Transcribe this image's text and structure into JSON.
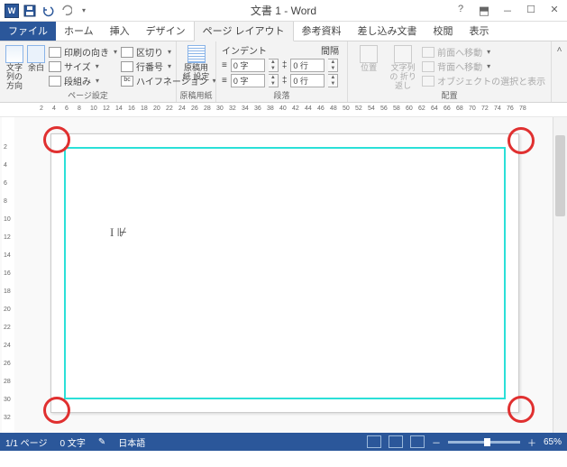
{
  "title": "文書 1 - Word",
  "tabs": {
    "file": "ファイル",
    "home": "ホーム",
    "insert": "挿入",
    "design": "デザイン",
    "pagelayout": "ページ レイアウト",
    "references": "参考資料",
    "mailings": "差し込み文書",
    "review": "校閲",
    "view": "表示"
  },
  "ribbon": {
    "text_dir": "文字列の\n方向",
    "margins": "余白",
    "orientation": "印刷の向き",
    "size": "サイズ",
    "columns": "段組み",
    "breaks": "区切り",
    "line_numbers": "行番号",
    "hyphenation": "ハイフネーション",
    "page_setup_label": "ページ設定",
    "manuscript": "原稿用紙\n設定",
    "manuscript_label": "原稿用紙",
    "indent_label": "インデント",
    "spacing_label": "間隔",
    "left_val": "0 字",
    "right_val": "0 字",
    "before_val": "0 行",
    "after_val": "0 行",
    "paragraph_label": "段落",
    "position": "位置",
    "wrap": "文字列の\n折り返し",
    "bring_forward": "前面へ移動",
    "send_backward": "背面へ移動",
    "selection_pane": "オブジェクトの選択と表示",
    "arrange_label": "配置"
  },
  "ruler_h": [
    "2",
    "4",
    "6",
    "8",
    "10",
    "12",
    "14",
    "16",
    "18",
    "20",
    "22",
    "24",
    "26",
    "28",
    "30",
    "32",
    "34",
    "36",
    "38",
    "40",
    "42",
    "44",
    "46",
    "48",
    "50",
    "52",
    "54",
    "56",
    "58",
    "60",
    "62",
    "64",
    "66",
    "68",
    "70",
    "72",
    "74",
    "76",
    "78"
  ],
  "ruler_v": [
    "2",
    "4",
    "6",
    "8",
    "10",
    "12",
    "14",
    "16",
    "18",
    "20",
    "22",
    "24",
    "26",
    "28",
    "30",
    "32"
  ],
  "status": {
    "page": "1/1 ページ",
    "words": "0 文字",
    "lang": "日本語",
    "zoom": "65%"
  }
}
